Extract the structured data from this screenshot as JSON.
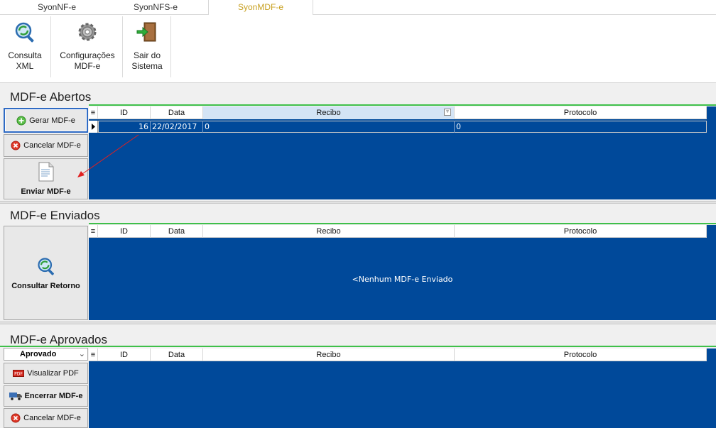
{
  "tabs": [
    "SyonNF-e",
    "SyonNFS-e",
    "SyonMDF-e"
  ],
  "ribbon": {
    "consulta": [
      "Consulta",
      "XML"
    ],
    "config": [
      "Configurações",
      "MDF-e"
    ],
    "sair": [
      "Sair do",
      "Sistema"
    ]
  },
  "abertos": {
    "title": "MDF-e Abertos",
    "buttons": {
      "gerar": "Gerar MDF-e",
      "cancelar": "Cancelar MDF-e",
      "enviar": "Enviar MDF-e"
    },
    "columns": [
      "ID",
      "Data",
      "Recibo",
      "Protocolo"
    ],
    "rows": [
      {
        "id": "16",
        "data": "22/02/2017",
        "recibo": "0",
        "protocolo": "0"
      }
    ]
  },
  "enviados": {
    "title": "MDF-e Enviados",
    "buttons": {
      "consultar": "Consultar Retorno"
    },
    "columns": [
      "ID",
      "Data",
      "Recibo",
      "Protocolo"
    ],
    "empty_message": "<Nenhum MDF-e Enviado"
  },
  "aprovados": {
    "title": "MDF-e Aprovados",
    "filter_value": "Aprovado",
    "buttons": {
      "visualizar": "Visualizar PDF",
      "encerrar": "Encerrar MDF-e",
      "cancelar": "Cancelar MDF-e"
    },
    "columns": [
      "ID",
      "Data",
      "Recibo",
      "Protocolo"
    ]
  },
  "icons": {
    "consulta": "search-refresh-icon",
    "config": "gear-icon",
    "sair": "exit-door-icon",
    "gerar": "plus-circle-icon",
    "cancelar": "cancel-icon",
    "enviar": "document-icon",
    "pdf": "pdf-icon",
    "truck": "truck-icon"
  },
  "colors": {
    "grid_bg": "#00499a",
    "accent_green": "#3fc04a",
    "active_tab": "#c8a020",
    "arrow": "#e02020"
  }
}
